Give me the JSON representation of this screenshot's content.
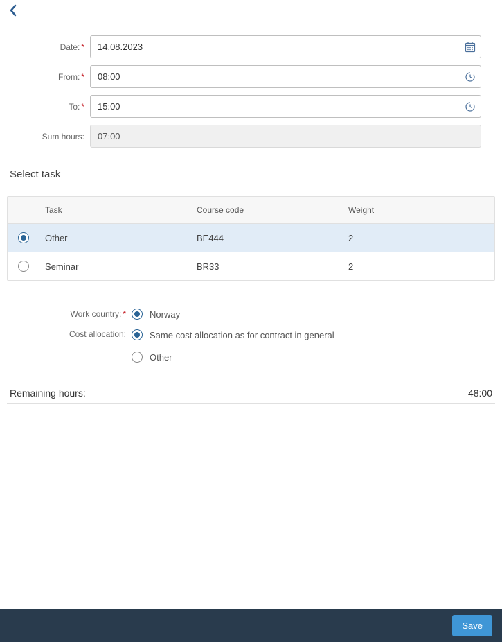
{
  "form": {
    "date_label": "Date:",
    "date_value": "14.08.2023",
    "from_label": "From:",
    "from_value": "08:00",
    "to_label": "To:",
    "to_value": "15:00",
    "sum_label": "Sum hours:",
    "sum_value": "07:00"
  },
  "task_section": {
    "title": "Select task",
    "columns": {
      "task": "Task",
      "course": "Course code",
      "weight": "Weight"
    },
    "rows": [
      {
        "selected": true,
        "task": "Other",
        "course": "BE444",
        "weight": "2"
      },
      {
        "selected": false,
        "task": "Seminar",
        "course": "BR33",
        "weight": "2"
      }
    ]
  },
  "work_country": {
    "label": "Work country:",
    "options": [
      {
        "label": "Norway",
        "checked": true
      }
    ]
  },
  "cost_allocation": {
    "label": "Cost allocation:",
    "options": [
      {
        "label": "Same cost allocation as for contract in general",
        "checked": true
      },
      {
        "label": "Other",
        "checked": false
      }
    ]
  },
  "remaining": {
    "label": "Remaining hours:",
    "value": "48:00"
  },
  "footer": {
    "save": "Save"
  }
}
